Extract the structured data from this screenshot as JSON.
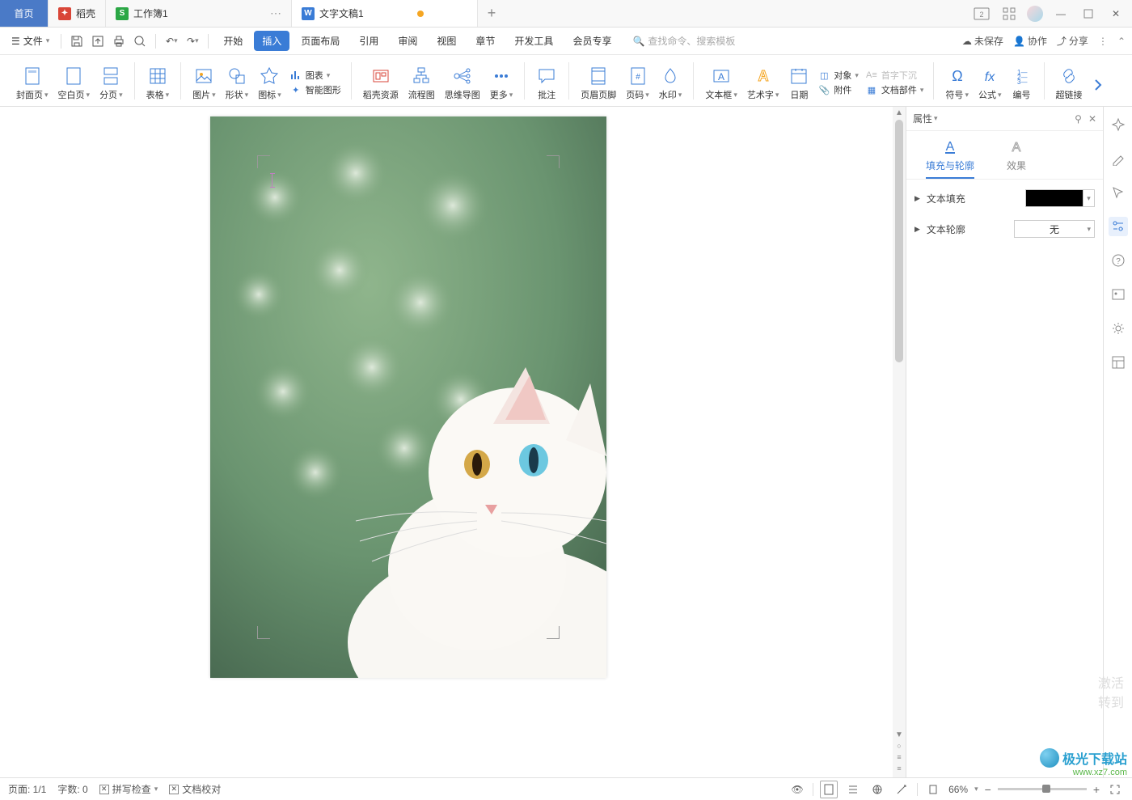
{
  "titlebar": {
    "home": "首页",
    "tabs": [
      {
        "icon": "red",
        "label": "稻壳"
      },
      {
        "icon": "green",
        "label": "工作簿1"
      },
      {
        "icon": "blue",
        "label": "文字文稿1",
        "active": true,
        "modified": true
      }
    ]
  },
  "menubar": {
    "file": "文件",
    "tabs": [
      "开始",
      "插入",
      "页面布局",
      "引用",
      "审阅",
      "视图",
      "章节",
      "开发工具",
      "会员专享"
    ],
    "active_tab": "插入",
    "search_placeholder": "查找命令、搜索模板",
    "right": {
      "unsaved": "未保存",
      "collab": "协作",
      "share": "分享"
    }
  },
  "ribbon": {
    "cover": "封面页",
    "blank": "空白页",
    "break": "分页",
    "table": "表格",
    "picture": "图片",
    "shape": "形状",
    "icon": "图标",
    "chart": "图表",
    "smart": "智能图形",
    "resource": "稻壳资源",
    "flowchart": "流程图",
    "mindmap": "思维导图",
    "more": "更多",
    "comment": "批注",
    "headerfooter": "页眉页脚",
    "pagenum": "页码",
    "watermark": "水印",
    "textbox": "文本框",
    "wordart": "艺术字",
    "date": "日期",
    "object": "对象",
    "attachment": "附件",
    "dropcap": "首字下沉",
    "docparts": "文档部件",
    "symbol": "符号",
    "equation": "公式",
    "number": "编号",
    "hyperlink": "超链接"
  },
  "properties": {
    "title": "属性",
    "tab_fill": "填充与轮廓",
    "tab_effect": "效果",
    "text_fill": "文本填充",
    "text_outline": "文本轮廓",
    "outline_value": "无",
    "fill_color": "#000000"
  },
  "statusbar": {
    "page": "页面: 1/1",
    "words": "字数: 0",
    "spellcheck": "拼写检查",
    "doccompare": "文档校对",
    "zoom": "66%"
  },
  "watermark": {
    "brand": "极光下载站",
    "url": "www.xz7.com"
  },
  "activate": {
    "line1": "激活",
    "line2": "转到"
  }
}
